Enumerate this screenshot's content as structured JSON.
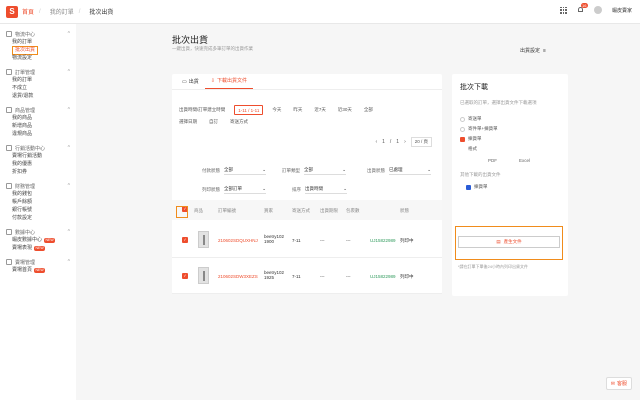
{
  "topbar": {
    "crumbs": [
      "首頁",
      "我的訂單",
      "批次出貨"
    ],
    "notif_count": "16",
    "username": "蝦皮賣家"
  },
  "sidebar": [
    {
      "title": "物流中心",
      "items": [
        {
          "label": "我的訂單"
        },
        {
          "label": "批次出貨",
          "active": true
        },
        {
          "label": "物流設定"
        }
      ]
    },
    {
      "title": "訂單管理",
      "items": [
        {
          "label": "我的訂單"
        },
        {
          "label": "不成立"
        },
        {
          "label": "退貨/退款"
        }
      ]
    },
    {
      "title": "商品管理",
      "items": [
        {
          "label": "我的商品"
        },
        {
          "label": "新增商品"
        },
        {
          "label": "違規商品"
        }
      ]
    },
    {
      "title": "行銷活動中心",
      "items": [
        {
          "label": "賣場行銷活動"
        },
        {
          "label": "我的優惠"
        },
        {
          "label": "折扣券"
        }
      ]
    },
    {
      "title": "財務管理",
      "items": [
        {
          "label": "我的錢包"
        },
        {
          "label": "帳戶餘額"
        },
        {
          "label": "銀行帳號"
        },
        {
          "label": "付款設定"
        }
      ]
    },
    {
      "title": "數據中心",
      "items": [
        {
          "label": "蝦皮數據中心",
          "tag": "NEW"
        },
        {
          "label": "賣場表現",
          "tag": "NEW"
        }
      ]
    },
    {
      "title": "賣場管理",
      "items": [
        {
          "label": "賣場首頁",
          "tag": "NEW"
        }
      ]
    }
  ],
  "page": {
    "title": "批次出貨",
    "subtitle": "一鍵出貨，快速完成多筆訂單的出貨作業",
    "ship_settings": "出貨設定"
  },
  "card": {
    "tabs": [
      {
        "label": "出貨"
      },
      {
        "label": "下載出貨文件",
        "active": true
      }
    ],
    "filter_label": "出貨時間/訂單建立時間",
    "chips": [
      "1-11 / 1-11",
      "今天",
      "昨天",
      "近7天",
      "近30天",
      "全部"
    ],
    "chips2": [
      "選擇日期",
      "自訂",
      "寄送方式"
    ],
    "pager": {
      "prev": "‹",
      "page": "1",
      "of": "/",
      "total": "1",
      "next": "›",
      "perpage": "20 / 頁"
    },
    "filters": [
      {
        "label": "付款狀態",
        "value": "全部"
      },
      {
        "label": "訂單類型",
        "value": "全部"
      },
      {
        "label": "出貨狀態",
        "value": "已處理"
      }
    ],
    "filters2": [
      {
        "label": "列印狀態",
        "value": "全部訂單"
      },
      {
        "label": "排序",
        "value": "出貨時間"
      }
    ],
    "table": {
      "headers": [
        "商品",
        "訂單編號",
        "買家",
        "寄送方式",
        "出貨期限",
        "包裹數",
        "物流追蹤號碼",
        "狀態"
      ],
      "rows": [
        {
          "sn": "210602SDQUXHNJ",
          "buyer": "beetry102 1900",
          "ship": "7-11",
          "deadline": "---",
          "pkgs": "---",
          "tracking": "UJ15822989",
          "status": "列印中"
        },
        {
          "sn": "210602SDW3XEZS",
          "buyer": "beetry102 1925",
          "ship": "7-11",
          "deadline": "---",
          "pkgs": "---",
          "tracking": "UJ15822989",
          "status": "列印中"
        }
      ]
    }
  },
  "panel": {
    "title": "批次下載",
    "subtitle": "已選取的訂單，選擇出貨文件下載選項",
    "options": [
      {
        "label": "寄送單"
      },
      {
        "label": "寄件單+揀貨單"
      },
      {
        "label": "揀貨單",
        "checked": true
      }
    ],
    "label_fmt": "格式",
    "formats": [
      "PDF",
      "Excel"
    ],
    "other_label": "其他下載的出貨文件",
    "other_opt": "揀貨單",
    "gen_button": "產生文件",
    "note": "*請在訂單下單後24小時內列印出貨文件"
  },
  "help_label": "客服"
}
